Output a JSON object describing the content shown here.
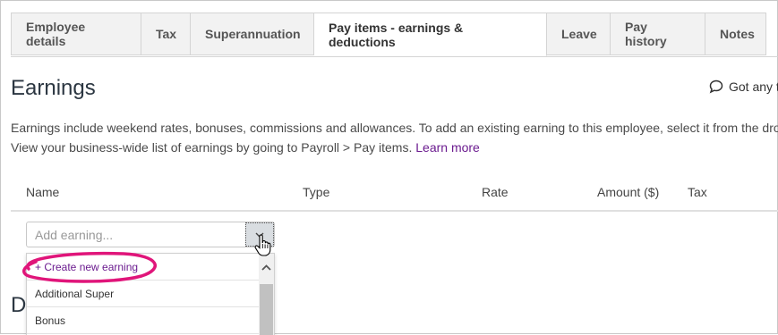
{
  "tabs": [
    {
      "label": "Employee details",
      "active": false
    },
    {
      "label": "Tax",
      "active": false
    },
    {
      "label": "Superannuation",
      "active": false
    },
    {
      "label": "Pay items - earnings & deductions",
      "active": true
    },
    {
      "label": "Leave",
      "active": false
    },
    {
      "label": "Pay history",
      "active": false
    },
    {
      "label": "Notes",
      "active": false
    }
  ],
  "page": {
    "title": "Earnings",
    "help_text": "Got any t",
    "description_line1": "Earnings include weekend rates, bonuses, commissions and allowances. To add an existing earning to this employee, select it from the dro",
    "description_line2": "View your business-wide list of earnings by going to Payroll > Pay items. ",
    "learn_more": "Learn more",
    "next_section_partial": "D"
  },
  "table": {
    "columns": [
      "Name",
      "Type",
      "Rate",
      "Amount ($)",
      "Tax"
    ]
  },
  "combo": {
    "placeholder": "Add earning..."
  },
  "dropdown": {
    "items": [
      "+ Create new earning",
      "Additional Super",
      "Bonus"
    ]
  },
  "colors": {
    "link": "#6b1b8f",
    "highlight_ring": "#e0157a"
  },
  "icons": {
    "help": "speech-bubble-icon",
    "combo": "chevron-down-icon",
    "cursor": "hand-pointer-icon",
    "scroll": "chevron-up-icon"
  }
}
